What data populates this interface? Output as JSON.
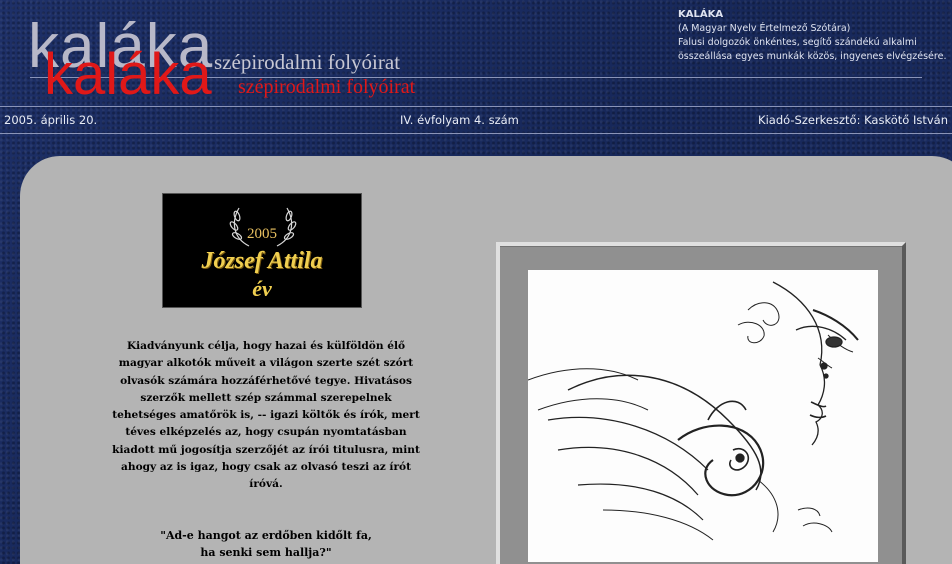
{
  "header": {
    "logo_ghost": "kaláka",
    "logo_main": "kaláka",
    "subtitle_ghost": "szépirodalmi folyóirat",
    "subtitle_main": "szépirodalmi folyóirat"
  },
  "info": {
    "title": "KALÁKA",
    "lines": [
      "(A Magyar Nyelv Értelmező Szótára)",
      "Falusi dolgozók önkéntes, segítő szándékú alkalmi",
      "összeállása egyes munkák közös, ingyenes elvégzésére."
    ]
  },
  "bar": {
    "date": "2005. április 20.",
    "issue": "IV. évfolyam 4. szám",
    "editor": "Kiadó-Szerkesztő: Kaskötő István"
  },
  "badge": {
    "year": "2005",
    "name": "József Attila",
    "word": "év"
  },
  "body": {
    "text": "Kiadványunk célja, hogy hazai és külföldön élő magyar alkotók műveit a világon szerte szét szórt olvasók számára hozzáférhetővé tegye. Hivatásos szerzők mellett szép számmal szerepelnek tehetséges amatőrök is, -- igazi költők és írók, mert téves elképzelés az, hogy csupán nyomtatásban kiadott mű jogosítja szerzőjét az írói titulusra, mint ahogy az is igaz, hogy csak az olvasó teszi az írót íróvá.",
    "quote_line1": "\"Ad-e hangot az erdőben kidőlt  fa,",
    "quote_line2": "ha senki sem hallja?\""
  },
  "colors": {
    "background": "#1a2a5c",
    "accent_red": "#e01818",
    "panel": "#b4b4b4",
    "gold": "#f0cf50"
  }
}
